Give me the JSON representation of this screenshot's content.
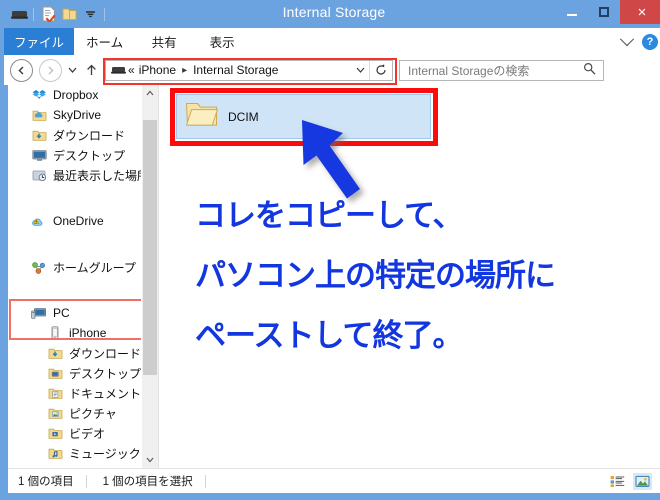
{
  "window": {
    "title": "Internal Storage",
    "quick_access": [
      {
        "name": "device-properties-icon",
        "label": "デバイス"
      },
      {
        "name": "properties-icon",
        "label": "プロパティ"
      },
      {
        "name": "new-folder-icon",
        "label": "新しいフォルダー"
      },
      {
        "name": "qat-dropdown-icon",
        "label": "▼"
      }
    ],
    "controls": {
      "minimize": "minimize-button",
      "maximize": "maximize-button",
      "close": "×"
    }
  },
  "ribbon": {
    "tabs": [
      {
        "label": "ファイル",
        "active": true
      },
      {
        "label": "ホーム",
        "active": false
      },
      {
        "label": "共有",
        "active": false
      },
      {
        "label": "表示",
        "active": false
      }
    ],
    "collapse_label": "∨",
    "help_label": "?"
  },
  "addressbar": {
    "back_label": "◀",
    "forward_label": "▶",
    "recent_label": "▼",
    "up_label": "↑",
    "device_icon": "device-icon",
    "prefix": "«",
    "crumbs": [
      "iPhone",
      "Internal Storage"
    ],
    "crumb_separator": "▸",
    "dropdown_label": "∨",
    "refresh_label": "↻",
    "highlight_color": "#f2352b"
  },
  "search": {
    "placeholder": "Internal Storageの検索",
    "icon_label": "search-icon"
  },
  "sidebar": {
    "scroll_up_label": "∧",
    "scroll_down_label": "∨",
    "groups": [
      {
        "items": [
          {
            "label": "Dropbox",
            "icon": "dropbox-icon",
            "level": 1
          },
          {
            "label": "SkyDrive",
            "icon": "skydrive-folder-icon",
            "level": 1
          },
          {
            "label": "ダウンロード",
            "icon": "downloads-folder-icon",
            "level": 1
          },
          {
            "label": "デスクトップ",
            "icon": "desktop-icon",
            "level": 1
          },
          {
            "label": "最近表示した場所",
            "icon": "recent-places-icon",
            "level": 1
          }
        ]
      },
      {
        "items": [
          {
            "label": "OneDrive",
            "icon": "onedrive-icon",
            "level": 1
          }
        ]
      },
      {
        "items": [
          {
            "label": "ホームグループ",
            "icon": "homegroup-icon",
            "level": 1
          }
        ]
      },
      {
        "items": [
          {
            "label": "PC",
            "icon": "pc-icon",
            "level": 1
          },
          {
            "label": "iPhone",
            "icon": "iphone-icon",
            "level": 2
          },
          {
            "label": "ダウンロード",
            "icon": "downloads-folder-icon",
            "level": 2
          },
          {
            "label": "デスクトップ",
            "icon": "desktop-folder-icon",
            "level": 2
          },
          {
            "label": "ドキュメント",
            "icon": "documents-folder-icon",
            "level": 2
          },
          {
            "label": "ピクチャ",
            "icon": "pictures-folder-icon",
            "level": 2
          },
          {
            "label": "ビデオ",
            "icon": "videos-folder-icon",
            "level": 2
          },
          {
            "label": "ミュージック",
            "icon": "music-folder-icon",
            "level": 2
          }
        ]
      }
    ],
    "highlight_color": "#f07068"
  },
  "files": {
    "items": [
      {
        "name": "DCIM",
        "icon": "folder-icon",
        "selected": true
      }
    ],
    "highlight_color": "#fb0b0b"
  },
  "annotation": {
    "color": "#1237e0",
    "arrow": "arrow-up-left",
    "lines": [
      "コレをコピーして、",
      "パソコン上の特定の場所に",
      "ペーストして終了。"
    ]
  },
  "statusbar": {
    "item_count": "1 個の項目",
    "selection": "1 個の項目を選択",
    "views": [
      {
        "name": "details-view-button",
        "selected": false
      },
      {
        "name": "large-icons-view-button",
        "selected": true
      }
    ]
  }
}
